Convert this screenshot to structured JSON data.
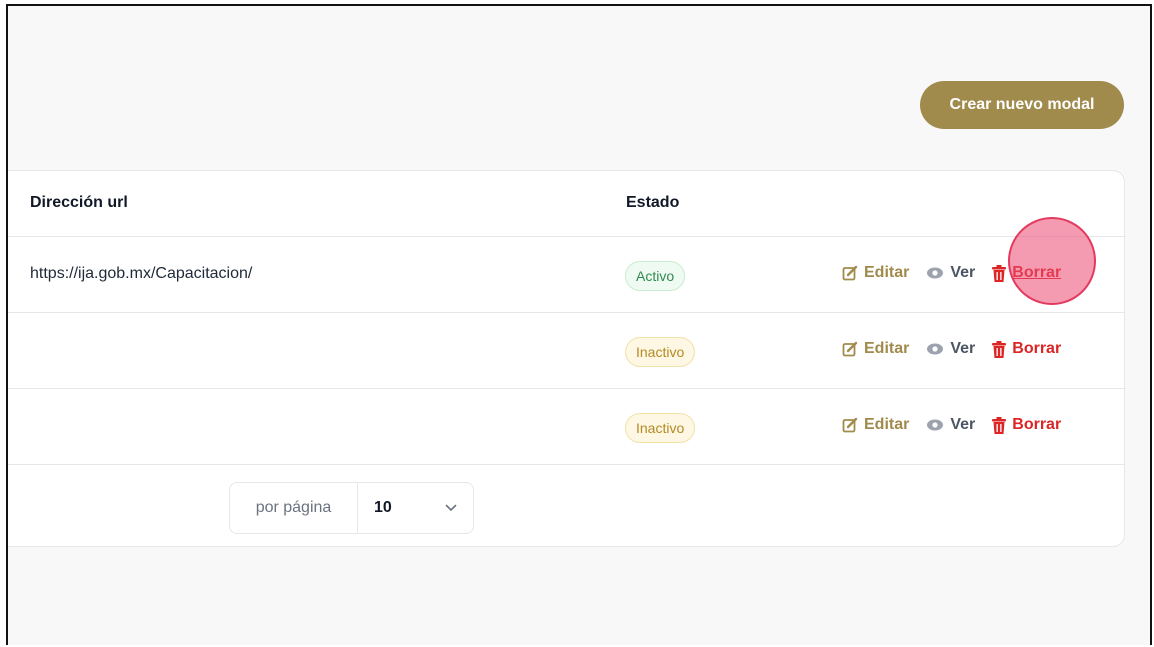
{
  "toolbar": {
    "create_label": "Crear nuevo modal"
  },
  "table": {
    "headers": {
      "url": "Dirección url",
      "status": "Estado"
    },
    "rows": [
      {
        "url": "https://ija.gob.mx/Capacitacion/",
        "status": "Activo",
        "status_kind": "active"
      },
      {
        "url": "",
        "status": "Inactivo",
        "status_kind": "inactive"
      },
      {
        "url": "",
        "status": "Inactivo",
        "status_kind": "inactive"
      }
    ],
    "actions": {
      "edit": "Editar",
      "view": "Ver",
      "delete": "Borrar"
    }
  },
  "pagination": {
    "per_page_label": "por página",
    "per_page_value": "10"
  },
  "colors": {
    "accent": "#a08a4c",
    "danger": "#dc2626",
    "active": "#2f8a4f",
    "inactive": "#b48a24"
  },
  "icons": {
    "edit": "pencil-square-icon",
    "view": "eye-icon",
    "delete": "trash-icon",
    "select": "chevron-down-icon"
  }
}
